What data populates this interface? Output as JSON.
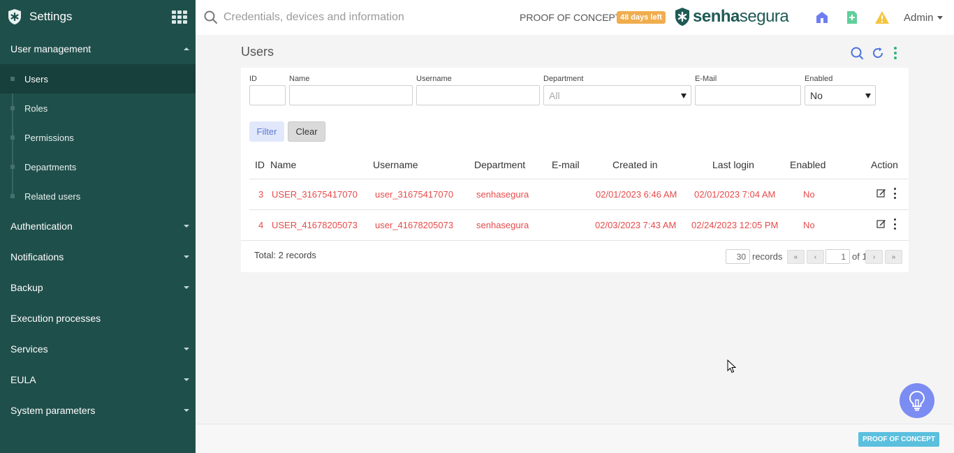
{
  "sidebar": {
    "title": "Settings",
    "sections": [
      {
        "label": "User management",
        "expanded": true,
        "items": [
          "Users",
          "Roles",
          "Permissions",
          "Departments",
          "Related users"
        ],
        "active": "Users"
      },
      {
        "label": "Authentication"
      },
      {
        "label": "Notifications"
      },
      {
        "label": "Backup"
      },
      {
        "label": "Execution processes"
      },
      {
        "label": "Services"
      },
      {
        "label": "EULA"
      },
      {
        "label": "System parameters"
      }
    ]
  },
  "topbar": {
    "search_placeholder": "Credentials, devices and information",
    "poc_label": "PROOF OF CONCEPT",
    "days_left": "48 days left",
    "brand_bold": "senha",
    "brand_rest": "segura",
    "user": "Admin"
  },
  "page": {
    "title": "Users",
    "filters": {
      "id_label": "ID",
      "id_value": "",
      "name_label": "Name",
      "name_value": "",
      "username_label": "Username",
      "username_value": "",
      "department_label": "Department",
      "department_value": "All",
      "email_label": "E-Mail",
      "email_value": "",
      "enabled_label": "Enabled",
      "enabled_value": "No",
      "filter_button": "Filter",
      "clear_button": "Clear"
    },
    "table": {
      "columns": [
        "ID",
        "Name",
        "Username",
        "Department",
        "E-mail",
        "Created in",
        "Last login",
        "Enabled",
        "Action"
      ],
      "rows": [
        {
          "id": "3",
          "name": "USER_31675417070",
          "username": "user_31675417070",
          "department": "senhasegura",
          "email": "",
          "created": "02/01/2023 6:46 AM",
          "last_login": "02/01/2023 7:04 AM",
          "enabled": "No"
        },
        {
          "id": "4",
          "name": "USER_41678205073",
          "username": "user_41678205073",
          "department": "senhasegura",
          "email": "",
          "created": "02/03/2023 7:43 AM",
          "last_login": "02/24/2023 12:05 PM",
          "enabled": "No"
        }
      ]
    },
    "pagination": {
      "total_text": "Total: 2 records",
      "per_page": "30",
      "records_label": "records",
      "page": "1",
      "of_label": "of 1",
      "first": "«",
      "prev": "‹",
      "next": "›",
      "last": "»"
    }
  },
  "footer": {
    "badge": "PROOF OF CONCEPT"
  },
  "colors": {
    "sidebar": "#1f4f4b",
    "accent_red": "#e84a4a",
    "badge_orange": "#f0ad4e",
    "poc_blue": "#5bc0de",
    "tips_purple": "#7b8cf2"
  }
}
